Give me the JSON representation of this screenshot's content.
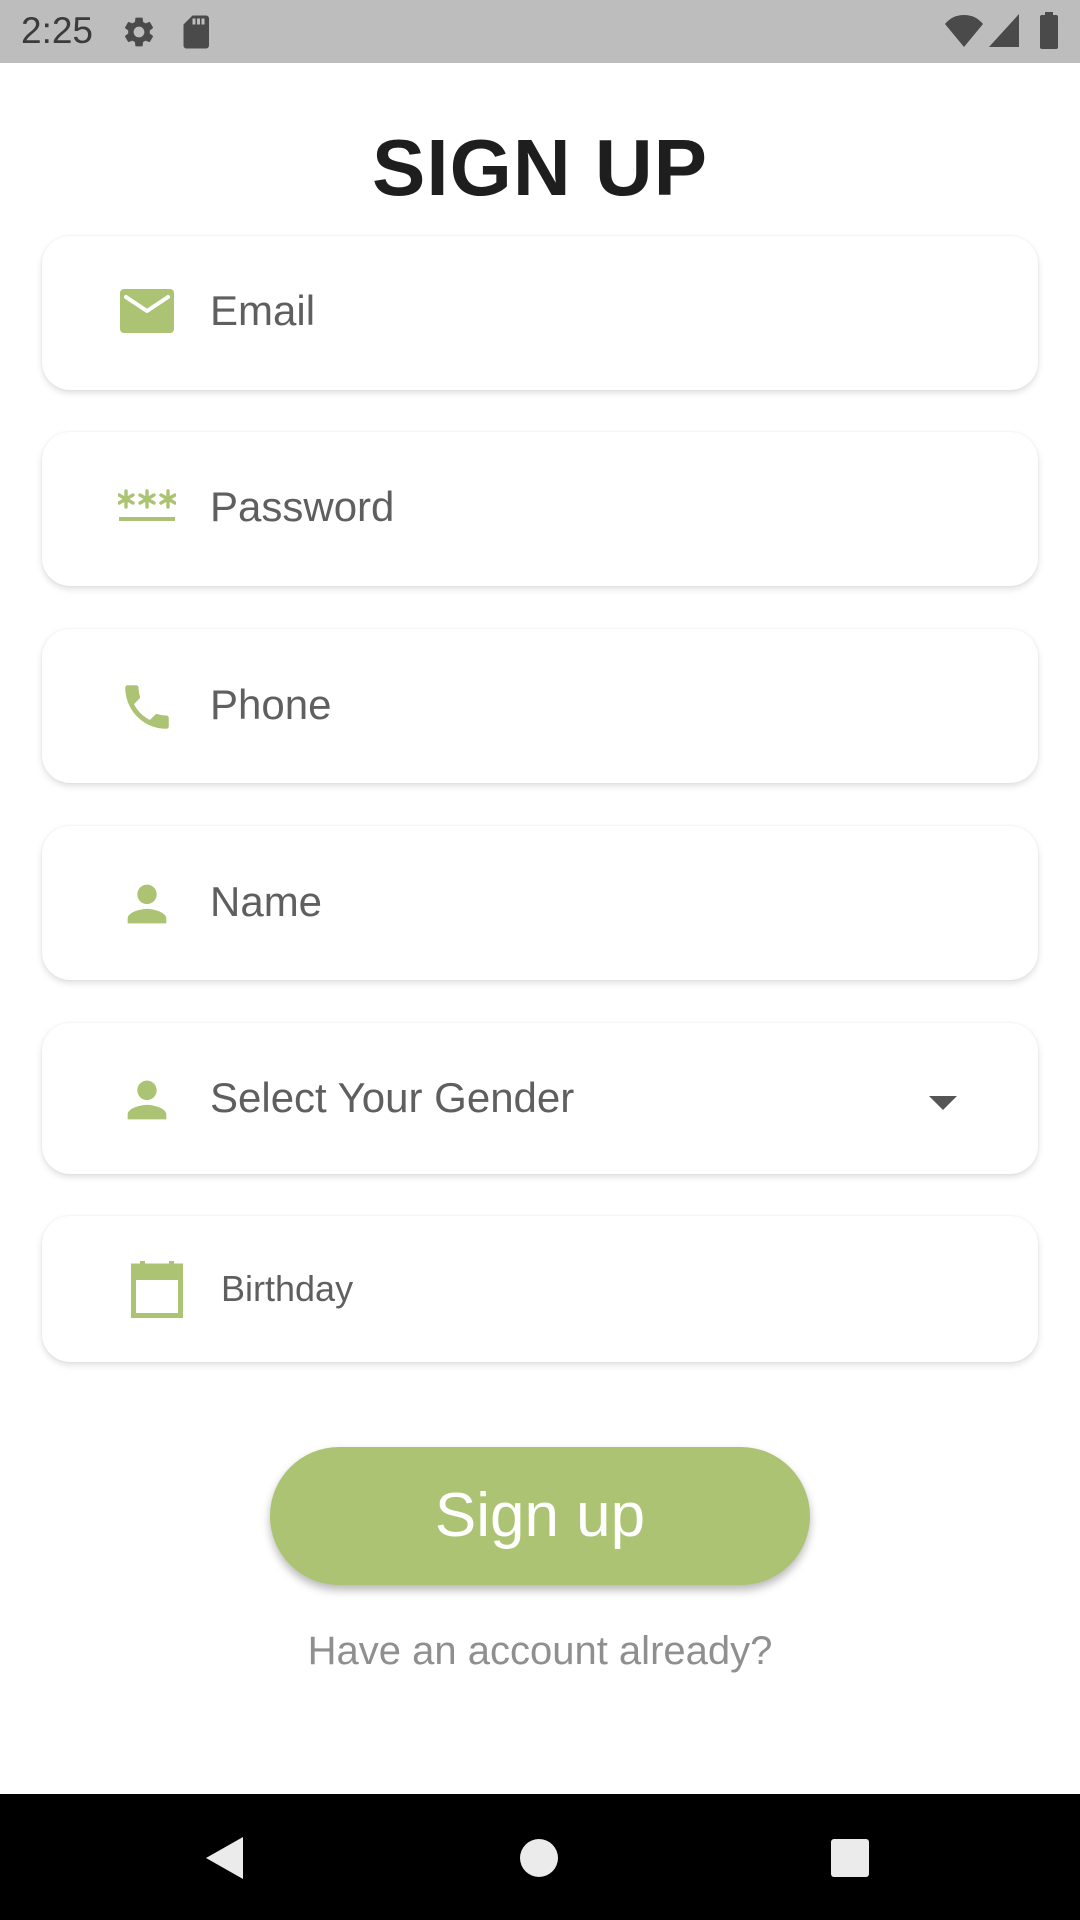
{
  "status_bar": {
    "time": "2:25",
    "icons": [
      "gear-icon",
      "sd-card-icon",
      "wifi-icon",
      "signal-icon",
      "battery-icon"
    ]
  },
  "page": {
    "title": "SIGN UP"
  },
  "form": {
    "email": {
      "placeholder": "Email",
      "icon": "email-icon"
    },
    "password": {
      "placeholder": "Password",
      "icon": "password-icon"
    },
    "phone": {
      "placeholder": "Phone",
      "icon": "phone-icon"
    },
    "name": {
      "placeholder": "Name",
      "icon": "person-icon"
    },
    "gender": {
      "placeholder": "Select Your Gender",
      "icon": "person-icon"
    },
    "birthday": {
      "placeholder": "Birthday",
      "icon": "calendar-icon"
    }
  },
  "actions": {
    "signup_label": "Sign up",
    "have_account_label": "Have an account already?"
  },
  "nav_bar": {
    "buttons": [
      "back-icon",
      "home-icon",
      "recents-icon"
    ]
  },
  "colors": {
    "accent": "#abc372",
    "status_bar_bg": "#bdbdbd",
    "title_text": "#1e1e1e",
    "placeholder_text": "#5f5f5f",
    "link_text": "#8f8f8f",
    "nav_bar_bg": "#000000"
  }
}
